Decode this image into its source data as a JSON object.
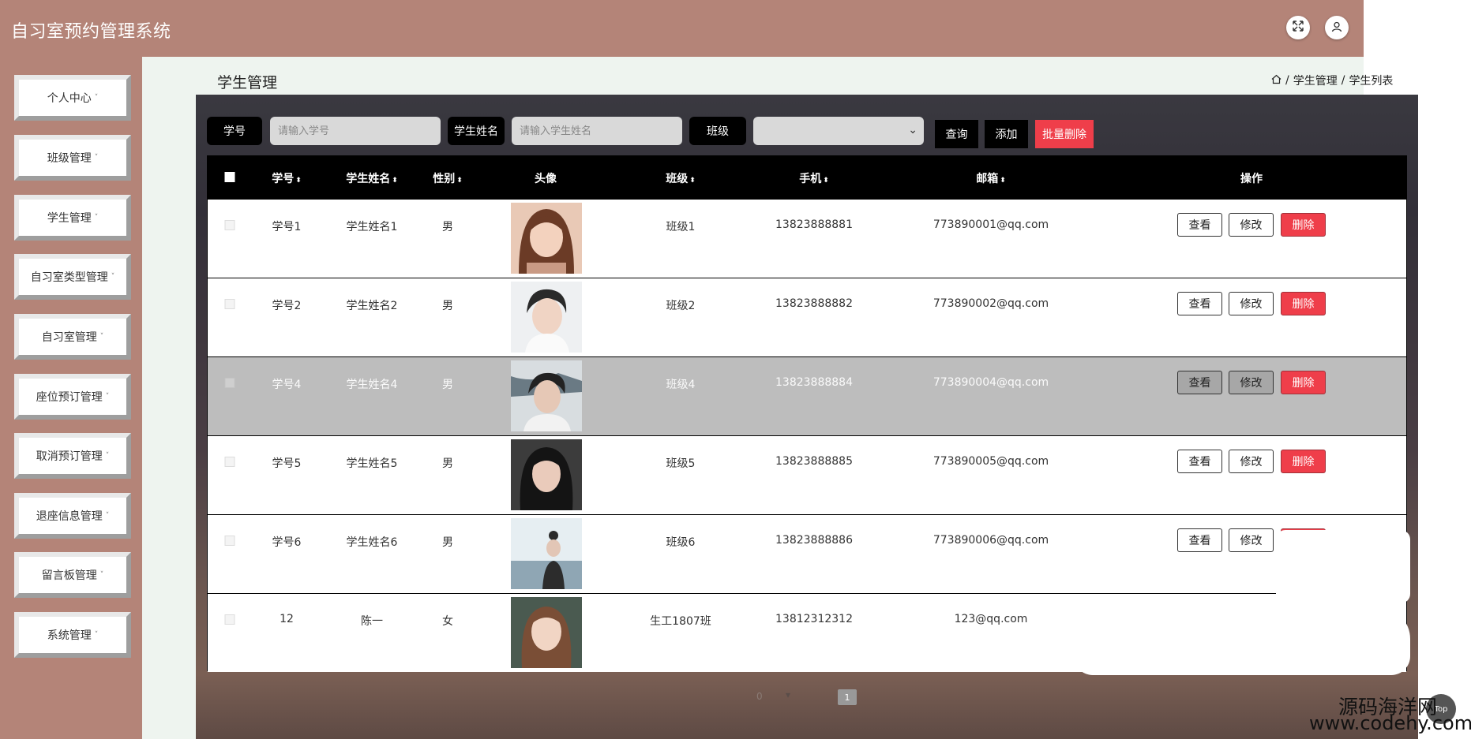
{
  "app": {
    "title": "自习室预约管理系统"
  },
  "header": {
    "fullscreen_icon": "expand-icon",
    "user_icon": "user-icon"
  },
  "sidebar": {
    "items": [
      {
        "label": "个人中心"
      },
      {
        "label": "班级管理"
      },
      {
        "label": "学生管理"
      },
      {
        "label": "自习室类型管理"
      },
      {
        "label": "自习室管理"
      },
      {
        "label": "座位预订管理"
      },
      {
        "label": "取消预订管理"
      },
      {
        "label": "退座信息管理"
      },
      {
        "label": "留言板管理"
      },
      {
        "label": "系统管理"
      }
    ],
    "arrow": "˅"
  },
  "page": {
    "title": "学生管理",
    "breadcrumb": [
      "学生管理",
      "学生列表"
    ],
    "breadcrumb_sep": "/"
  },
  "search": {
    "student_no_label": "学号",
    "student_no_placeholder": "请输入学号",
    "student_name_label": "学生姓名",
    "student_name_placeholder": "请输入学生姓名",
    "class_label": "班级",
    "class_value": "",
    "query_label": "查询",
    "add_label": "添加",
    "batch_delete_label": "批量删除"
  },
  "table": {
    "headers": {
      "student_no": "学号",
      "student_name": "学生姓名",
      "gender": "性别",
      "avatar": "头像",
      "class": "班级",
      "phone": "手机",
      "email": "邮箱",
      "ops": "操作"
    },
    "sort_icon": "⬍",
    "rows": [
      {
        "student_no": "学号1",
        "student_name": "学生姓名1",
        "gender": "男",
        "class": "班级1",
        "phone": "13823888881",
        "email": "773890001@qq.com",
        "highlight": false
      },
      {
        "student_no": "学号2",
        "student_name": "学生姓名2",
        "gender": "男",
        "class": "班级2",
        "phone": "13823888882",
        "email": "773890002@qq.com",
        "highlight": false
      },
      {
        "student_no": "学号4",
        "student_name": "学生姓名4",
        "gender": "男",
        "class": "班级4",
        "phone": "13823888884",
        "email": "773890004@qq.com",
        "highlight": true
      },
      {
        "student_no": "学号5",
        "student_name": "学生姓名5",
        "gender": "男",
        "class": "班级5",
        "phone": "13823888885",
        "email": "773890005@qq.com",
        "highlight": false
      },
      {
        "student_no": "学号6",
        "student_name": "学生姓名6",
        "gender": "男",
        "class": "班级6",
        "phone": "13823888886",
        "email": "773890006@qq.com",
        "highlight": false
      },
      {
        "student_no": "12",
        "student_name": "陈一",
        "gender": "女",
        "class": "生工1807班",
        "phone": "13812312312",
        "email": "123@qq.com",
        "highlight": false
      }
    ],
    "ops": {
      "view": "查看",
      "edit": "修改",
      "delete": "删除"
    }
  },
  "pagination": {
    "current_page": "1",
    "page_size_value": "0"
  },
  "colors": {
    "header_bg": "#b48478",
    "delete_red": "#ef3e4a",
    "black": "#000000"
  },
  "watermark": {
    "line1": "源码海洋网",
    "line2": "www.codehy.com"
  },
  "top_button": "Top"
}
